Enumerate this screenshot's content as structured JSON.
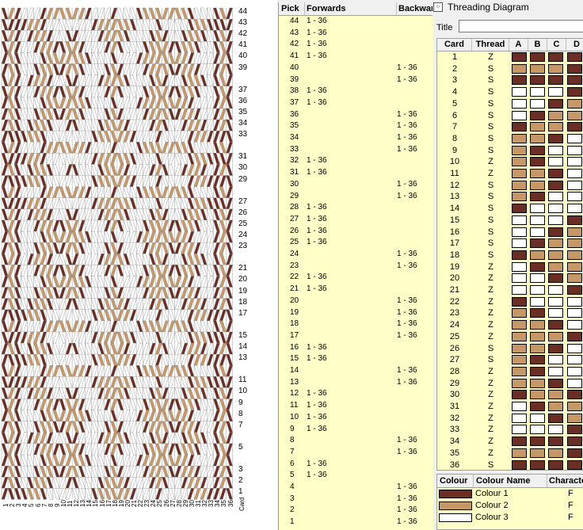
{
  "threading_window": {
    "title": "Threading Diagram",
    "icon": "grid-icon",
    "title_label": "Title",
    "title_value": ""
  },
  "pick_table": {
    "headers": {
      "pick": "Pick",
      "forwards": "Forwards",
      "backwards": "Backwar"
    },
    "rows": [
      {
        "pick": "44",
        "forwards": "1 - 36",
        "backwards": ""
      },
      {
        "pick": "43",
        "forwards": "1 - 36",
        "backwards": ""
      },
      {
        "pick": "42",
        "forwards": "1 - 36",
        "backwards": ""
      },
      {
        "pick": "41",
        "forwards": "1 - 36",
        "backwards": ""
      },
      {
        "pick": "40",
        "forwards": "",
        "backwards": "1 - 36"
      },
      {
        "pick": "39",
        "forwards": "",
        "backwards": "1 - 36"
      },
      {
        "pick": "38",
        "forwards": "1 - 36",
        "backwards": ""
      },
      {
        "pick": "37",
        "forwards": "1 - 36",
        "backwards": ""
      },
      {
        "pick": "36",
        "forwards": "",
        "backwards": "1 - 36"
      },
      {
        "pick": "35",
        "forwards": "",
        "backwards": "1 - 36"
      },
      {
        "pick": "34",
        "forwards": "",
        "backwards": "1 - 36"
      },
      {
        "pick": "33",
        "forwards": "",
        "backwards": "1 - 36"
      },
      {
        "pick": "32",
        "forwards": "1 - 36",
        "backwards": ""
      },
      {
        "pick": "31",
        "forwards": "1 - 36",
        "backwards": ""
      },
      {
        "pick": "30",
        "forwards": "",
        "backwards": "1 - 36"
      },
      {
        "pick": "29",
        "forwards": "",
        "backwards": "1 - 36"
      },
      {
        "pick": "28",
        "forwards": "1 - 36",
        "backwards": ""
      },
      {
        "pick": "27",
        "forwards": "1 - 36",
        "backwards": ""
      },
      {
        "pick": "26",
        "forwards": "1 - 36",
        "backwards": ""
      },
      {
        "pick": "25",
        "forwards": "1 - 36",
        "backwards": ""
      },
      {
        "pick": "24",
        "forwards": "",
        "backwards": "1 - 36"
      },
      {
        "pick": "23",
        "forwards": "",
        "backwards": "1 - 36"
      },
      {
        "pick": "22",
        "forwards": "1 - 36",
        "backwards": ""
      },
      {
        "pick": "21",
        "forwards": "1 - 36",
        "backwards": ""
      },
      {
        "pick": "20",
        "forwards": "",
        "backwards": "1 - 36"
      },
      {
        "pick": "19",
        "forwards": "",
        "backwards": "1 - 36"
      },
      {
        "pick": "18",
        "forwards": "",
        "backwards": "1 - 36"
      },
      {
        "pick": "17",
        "forwards": "",
        "backwards": "1 - 36"
      },
      {
        "pick": "16",
        "forwards": "1 - 36",
        "backwards": ""
      },
      {
        "pick": "15",
        "forwards": "1 - 36",
        "backwards": ""
      },
      {
        "pick": "14",
        "forwards": "",
        "backwards": "1 - 36"
      },
      {
        "pick": "13",
        "forwards": "",
        "backwards": "1 - 36"
      },
      {
        "pick": "12",
        "forwards": "1 - 36",
        "backwards": ""
      },
      {
        "pick": "11",
        "forwards": "1 - 36",
        "backwards": ""
      },
      {
        "pick": "10",
        "forwards": "1 - 36",
        "backwards": ""
      },
      {
        "pick": "9",
        "forwards": "1 - 36",
        "backwards": ""
      },
      {
        "pick": "8",
        "forwards": "",
        "backwards": "1 - 36"
      },
      {
        "pick": "7",
        "forwards": "",
        "backwards": "1 - 36"
      },
      {
        "pick": "6",
        "forwards": "1 - 36",
        "backwards": ""
      },
      {
        "pick": "5",
        "forwards": "1 - 36",
        "backwards": ""
      },
      {
        "pick": "4",
        "forwards": "",
        "backwards": "1 - 36"
      },
      {
        "pick": "3",
        "forwards": "",
        "backwards": "1 - 36"
      },
      {
        "pick": "2",
        "forwards": "",
        "backwards": "1 - 36"
      },
      {
        "pick": "1",
        "forwards": "",
        "backwards": "1 - 36"
      }
    ]
  },
  "card_table": {
    "headers": {
      "card": "Card",
      "thread": "Thread",
      "holes": [
        "A",
        "B",
        "C",
        "D"
      ]
    },
    "rows": [
      {
        "card": "1",
        "thread": "Z",
        "holes": [
          1,
          1,
          1,
          1
        ]
      },
      {
        "card": "2",
        "thread": "S",
        "holes": [
          2,
          2,
          2,
          1
        ]
      },
      {
        "card": "3",
        "thread": "S",
        "holes": [
          1,
          1,
          1,
          1
        ]
      },
      {
        "card": "4",
        "thread": "S",
        "holes": [
          3,
          3,
          3,
          1
        ]
      },
      {
        "card": "5",
        "thread": "S",
        "holes": [
          3,
          3,
          1,
          2
        ]
      },
      {
        "card": "6",
        "thread": "S",
        "holes": [
          3,
          1,
          2,
          2
        ]
      },
      {
        "card": "7",
        "thread": "S",
        "holes": [
          1,
          2,
          2,
          1
        ]
      },
      {
        "card": "8",
        "thread": "S",
        "holes": [
          2,
          2,
          1,
          3
        ]
      },
      {
        "card": "9",
        "thread": "S",
        "holes": [
          2,
          1,
          3,
          3
        ]
      },
      {
        "card": "10",
        "thread": "Z",
        "holes": [
          2,
          1,
          3,
          3
        ]
      },
      {
        "card": "11",
        "thread": "Z",
        "holes": [
          2,
          2,
          1,
          3
        ]
      },
      {
        "card": "12",
        "thread": "S",
        "holes": [
          2,
          2,
          1,
          3
        ]
      },
      {
        "card": "13",
        "thread": "S",
        "holes": [
          2,
          1,
          3,
          3
        ]
      },
      {
        "card": "14",
        "thread": "S",
        "holes": [
          1,
          3,
          3,
          3
        ]
      },
      {
        "card": "15",
        "thread": "S",
        "holes": [
          3,
          3,
          3,
          1
        ]
      },
      {
        "card": "16",
        "thread": "S",
        "holes": [
          3,
          3,
          1,
          2
        ]
      },
      {
        "card": "17",
        "thread": "S",
        "holes": [
          3,
          1,
          2,
          2
        ]
      },
      {
        "card": "18",
        "thread": "S",
        "holes": [
          1,
          2,
          2,
          2
        ]
      },
      {
        "card": "19",
        "thread": "Z",
        "holes": [
          3,
          1,
          2,
          2
        ]
      },
      {
        "card": "20",
        "thread": "Z",
        "holes": [
          3,
          3,
          1,
          2
        ]
      },
      {
        "card": "21",
        "thread": "Z",
        "holes": [
          3,
          3,
          3,
          1
        ]
      },
      {
        "card": "22",
        "thread": "Z",
        "holes": [
          1,
          3,
          3,
          3
        ]
      },
      {
        "card": "23",
        "thread": "Z",
        "holes": [
          2,
          1,
          3,
          3
        ]
      },
      {
        "card": "24",
        "thread": "Z",
        "holes": [
          2,
          2,
          1,
          3
        ]
      },
      {
        "card": "25",
        "thread": "Z",
        "holes": [
          2,
          2,
          2,
          1
        ]
      },
      {
        "card": "26",
        "thread": "S",
        "holes": [
          2,
          2,
          1,
          3
        ]
      },
      {
        "card": "27",
        "thread": "S",
        "holes": [
          2,
          1,
          3,
          3
        ]
      },
      {
        "card": "28",
        "thread": "Z",
        "holes": [
          2,
          1,
          3,
          3
        ]
      },
      {
        "card": "29",
        "thread": "Z",
        "holes": [
          2,
          2,
          1,
          3
        ]
      },
      {
        "card": "30",
        "thread": "Z",
        "holes": [
          1,
          2,
          2,
          1
        ]
      },
      {
        "card": "31",
        "thread": "Z",
        "holes": [
          3,
          1,
          2,
          2
        ]
      },
      {
        "card": "32",
        "thread": "Z",
        "holes": [
          3,
          3,
          1,
          2
        ]
      },
      {
        "card": "33",
        "thread": "Z",
        "holes": [
          3,
          3,
          3,
          1
        ]
      },
      {
        "card": "34",
        "thread": "Z",
        "holes": [
          1,
          1,
          1,
          1
        ]
      },
      {
        "card": "35",
        "thread": "Z",
        "holes": [
          2,
          2,
          2,
          1
        ]
      },
      {
        "card": "36",
        "thread": "S",
        "holes": [
          1,
          1,
          1,
          1
        ]
      }
    ]
  },
  "colour_table": {
    "headers": {
      "colour": "Colour",
      "colour_name": "Colour Name",
      "character": "Characte"
    },
    "rows": [
      {
        "name": "Colour 1",
        "character": "F",
        "color": "#6b2e24"
      },
      {
        "name": "Colour 2",
        "character": "F",
        "color": "#c69868"
      },
      {
        "name": "Colour 3",
        "character": "F",
        "color": "#ffffff"
      }
    ]
  },
  "weave": {
    "pick_labels": [
      "44",
      "43",
      "42",
      "41",
      "40",
      "39",
      "37",
      "36",
      "35",
      "34",
      "33",
      "31",
      "30",
      "29",
      "27",
      "26",
      "25",
      "24",
      "23",
      "21",
      "20",
      "19",
      "18",
      "17",
      "15",
      "14",
      "13",
      "11",
      "10",
      "9",
      "8",
      "7",
      "5",
      "3",
      "2",
      "1"
    ],
    "card_axis_suffix": "Card",
    "colors": {
      "colour1": "#6b2e24",
      "colour2": "#c69868",
      "colour3": "#ffffff",
      "grid": "#888888"
    }
  }
}
